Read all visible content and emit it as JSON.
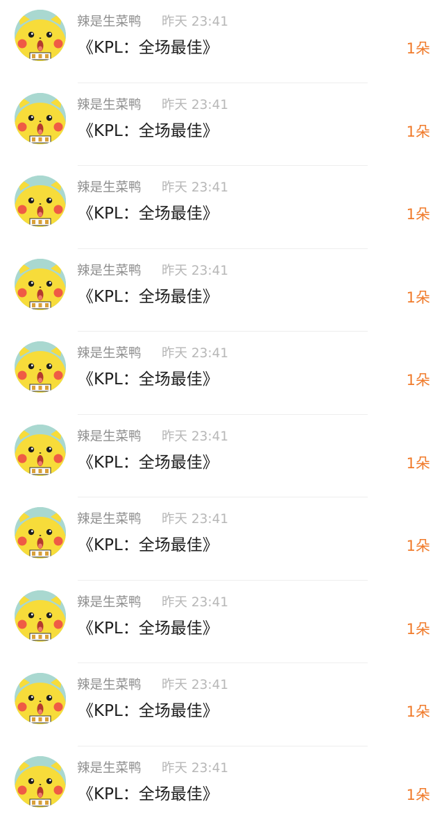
{
  "colors": {
    "sender": "#8f8f8f",
    "time": "#b7b7b7",
    "message": "#1e1e1e",
    "count": "#f07a2a",
    "avatar_bg": "#a9d8d0",
    "avatar_face": "#f7dc3a"
  },
  "avatar_icon": "pikachu-avatar-icon",
  "items": [
    {
      "sender": "辣是生菜鸭",
      "time": "昨天 23:41",
      "message": "《KPL：全场最佳》",
      "count": "1朵"
    },
    {
      "sender": "辣是生菜鸭",
      "time": "昨天 23:41",
      "message": "《KPL：全场最佳》",
      "count": "1朵"
    },
    {
      "sender": "辣是生菜鸭",
      "time": "昨天 23:41",
      "message": "《KPL：全场最佳》",
      "count": "1朵"
    },
    {
      "sender": "辣是生菜鸭",
      "time": "昨天 23:41",
      "message": "《KPL：全场最佳》",
      "count": "1朵"
    },
    {
      "sender": "辣是生菜鸭",
      "time": "昨天 23:41",
      "message": "《KPL：全场最佳》",
      "count": "1朵"
    },
    {
      "sender": "辣是生菜鸭",
      "time": "昨天 23:41",
      "message": "《KPL：全场最佳》",
      "count": "1朵"
    },
    {
      "sender": "辣是生菜鸭",
      "time": "昨天 23:41",
      "message": "《KPL：全场最佳》",
      "count": "1朵"
    },
    {
      "sender": "辣是生菜鸭",
      "time": "昨天 23:41",
      "message": "《KPL：全场最佳》",
      "count": "1朵"
    },
    {
      "sender": "辣是生菜鸭",
      "time": "昨天 23:41",
      "message": "《KPL：全场最佳》",
      "count": "1朵"
    },
    {
      "sender": "辣是生菜鸭",
      "time": "昨天 23:41",
      "message": "《KPL：全场最佳》",
      "count": "1朵"
    }
  ]
}
